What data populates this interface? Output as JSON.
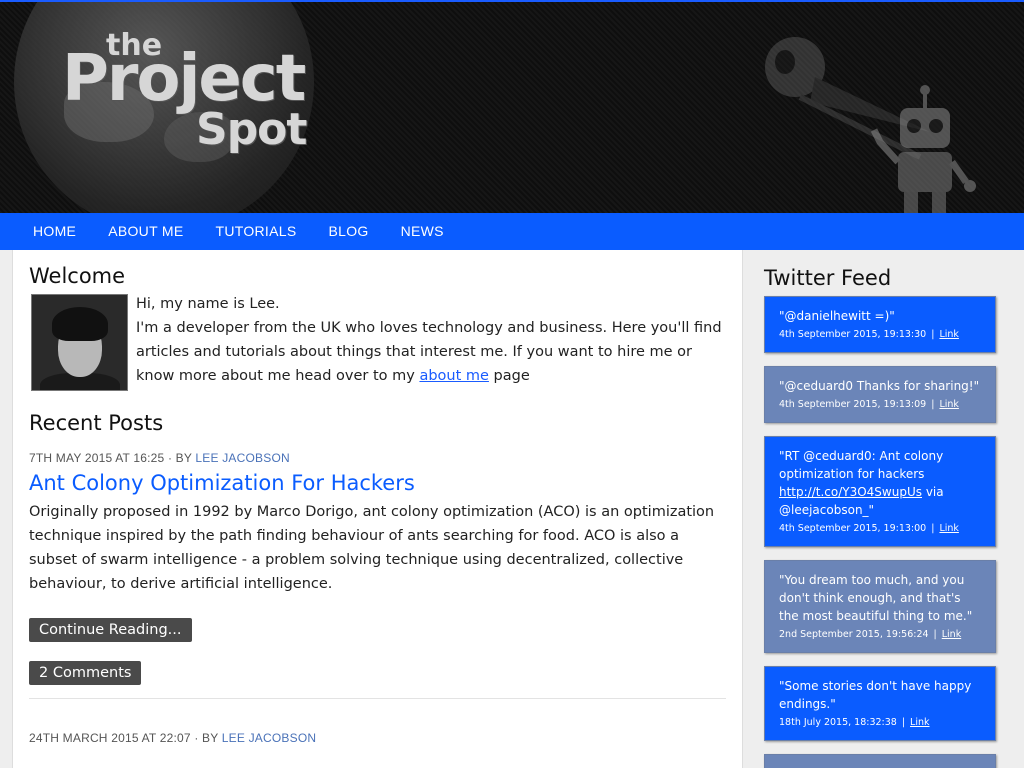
{
  "header": {
    "logo": {
      "the": "the",
      "project": "Project",
      "spot": "Spot"
    }
  },
  "nav": {
    "items": [
      {
        "label": "HOME"
      },
      {
        "label": "ABOUT ME"
      },
      {
        "label": "TUTORIALS"
      },
      {
        "label": "BLOG"
      },
      {
        "label": "NEWS"
      }
    ]
  },
  "welcome": {
    "title": "Welcome",
    "line1": "Hi, my name is Lee.",
    "line2_pre": "I'm a developer from the UK who loves technology and business. Here you'll find articles and tutorials about things that interest me. If you want to hire me or know more about me head over to my ",
    "link": "about me",
    "line2_post": " page"
  },
  "recent": {
    "title": "Recent Posts",
    "posts": [
      {
        "date": "7TH MAY 2015 AT 16:25",
        "by": "· BY",
        "author": "LEE JACOBSON",
        "title": "Ant Colony Optimization For Hackers",
        "body": "Originally proposed in 1992 by Marco Dorigo, ant colony optimization (ACO) is an optimization technique inspired by the path finding behaviour of ants searching for food. ACO is also a subset of swarm intelligence - a problem solving technique using decentralized, collective behaviour, to derive artificial intelligence.",
        "continue_label": "Continue Reading...",
        "comments_label": "2 Comments"
      },
      {
        "date": "24TH MARCH 2015 AT 22:07",
        "by": "· BY",
        "author": "LEE JACOBSON"
      }
    ]
  },
  "sidebar": {
    "title": "Twitter Feed",
    "tweets": [
      {
        "text": "\"@danielhewitt =)\"",
        "time": "4th September 2015, 19:13:30",
        "link": "Link",
        "style": "blue"
      },
      {
        "text": "\"@ceduard0 Thanks for sharing!\"",
        "time": "4th September 2015, 19:13:09",
        "link": "Link",
        "style": "slate"
      },
      {
        "text_pre": "\"RT @ceduard0: Ant colony optimization for hackers ",
        "url": "http://t.co/Y3O4SwupUs",
        "text_post": " via @leejacobson_\"",
        "time": "4th September 2015, 19:13:00",
        "link": "Link",
        "style": "blue"
      },
      {
        "text": "\"You dream too much, and you don't think enough, and that's the most beautiful thing to me.\"",
        "time": "2nd September 2015, 19:56:24",
        "link": "Link",
        "style": "slate"
      },
      {
        "text": "\"Some stories don't have happy endings.\"",
        "time": "18th July 2015, 18:32:38",
        "link": "Link",
        "style": "blue"
      }
    ],
    "separator": "|"
  },
  "colors": {
    "accent": "#0a5cff",
    "tweet_alt": "#6b85b8",
    "button": "#4a4a4a"
  }
}
